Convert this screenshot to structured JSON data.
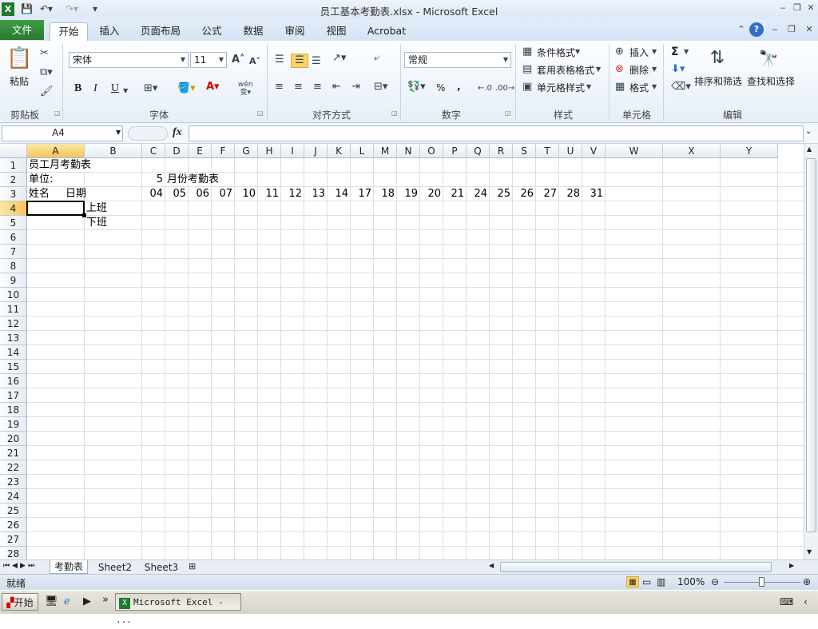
{
  "window": {
    "title": "员工基本考勤表.xlsx  -  Microsoft Excel"
  },
  "ribbon_tabs": [
    "文件",
    "开始",
    "插入",
    "页面布局",
    "公式",
    "数据",
    "审阅",
    "视图",
    "Acrobat"
  ],
  "ribbon": {
    "clipboard": {
      "paste": "粘贴",
      "label": "剪贴板"
    },
    "font": {
      "name": "宋体",
      "size": "11",
      "bold": "B",
      "italic": "I",
      "underline": "U",
      "label": "字体",
      "wen": "wén\n变"
    },
    "alignment": {
      "label": "对齐方式"
    },
    "number": {
      "format": "常规",
      "percent": "%",
      "comma": ",",
      "label": "数字"
    },
    "styles": {
      "conditional": "条件格式",
      "table": "套用表格格式",
      "cell": "单元格样式",
      "label": "样式"
    },
    "cells": {
      "insert": "插入",
      "delete": "删除",
      "format": "格式",
      "label": "单元格"
    },
    "editing": {
      "sort": "排序和筛选",
      "find": "查找和选择",
      "label": "编辑",
      "sigma": "Σ"
    }
  },
  "formula_bar": {
    "name_box": "A4",
    "fx": "fx",
    "content": ""
  },
  "columns": [
    "A",
    "B",
    "C",
    "D",
    "E",
    "F",
    "G",
    "H",
    "I",
    "J",
    "K",
    "L",
    "M",
    "N",
    "O",
    "P",
    "Q",
    "R",
    "S",
    "T",
    "U",
    "V",
    "W",
    "X",
    "Y"
  ],
  "rows": [
    "1",
    "2",
    "3",
    "4",
    "5",
    "6",
    "7",
    "8",
    "9",
    "10",
    "11",
    "12",
    "13",
    "14",
    "15",
    "16",
    "17",
    "18",
    "19",
    "20",
    "21",
    "22",
    "23",
    "24",
    "25",
    "26",
    "27",
    "28"
  ],
  "cells": {
    "r1": {
      "A": "员工月考勤表"
    },
    "r2": {
      "A": "单位:",
      "C": "5",
      "D": "月份考勤表"
    },
    "r3": {
      "A": "姓名",
      "A2": "日期",
      "days": [
        "04",
        "05",
        "06",
        "07",
        "10",
        "11",
        "12",
        "13",
        "14",
        "17",
        "18",
        "19",
        "20",
        "21",
        "24",
        "25",
        "26",
        "27",
        "28",
        "31"
      ]
    },
    "r4": {
      "B": "上班"
    },
    "r5": {
      "B": "下班"
    }
  },
  "sheets": [
    "考勤表",
    "Sheet2",
    "Sheet3"
  ],
  "status": {
    "ready": "就绪",
    "zoom": "100%"
  },
  "taskbar": {
    "start": "开始",
    "app": "Microsoft Excel - ..."
  }
}
